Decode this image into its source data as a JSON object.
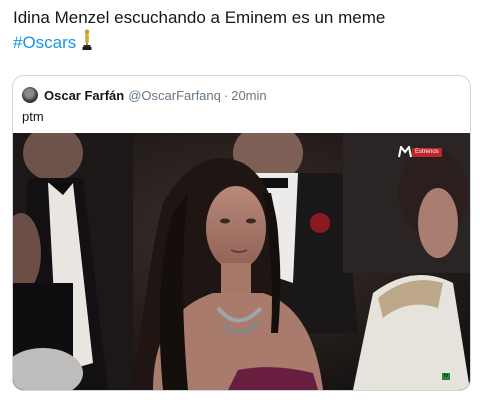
{
  "tweet": {
    "text_line1": "Idina Menzel escuchando a Eminem es un meme",
    "hashtag": "#Oscars",
    "emoji": "trophy-icon"
  },
  "quoted_tweet": {
    "display_name": "Oscar Farfán",
    "handle": "@OscarFarfanq",
    "separator": "·",
    "time": "20min",
    "text": "ptm",
    "media": {
      "description_icon": "tv-broadcast-still",
      "channel_logo": "M",
      "live_badge": "Estrenos"
    }
  },
  "colors": {
    "link": "#1b95e0",
    "text": "#14171a",
    "secondary": "#657786",
    "border": "#ccd6dd"
  }
}
